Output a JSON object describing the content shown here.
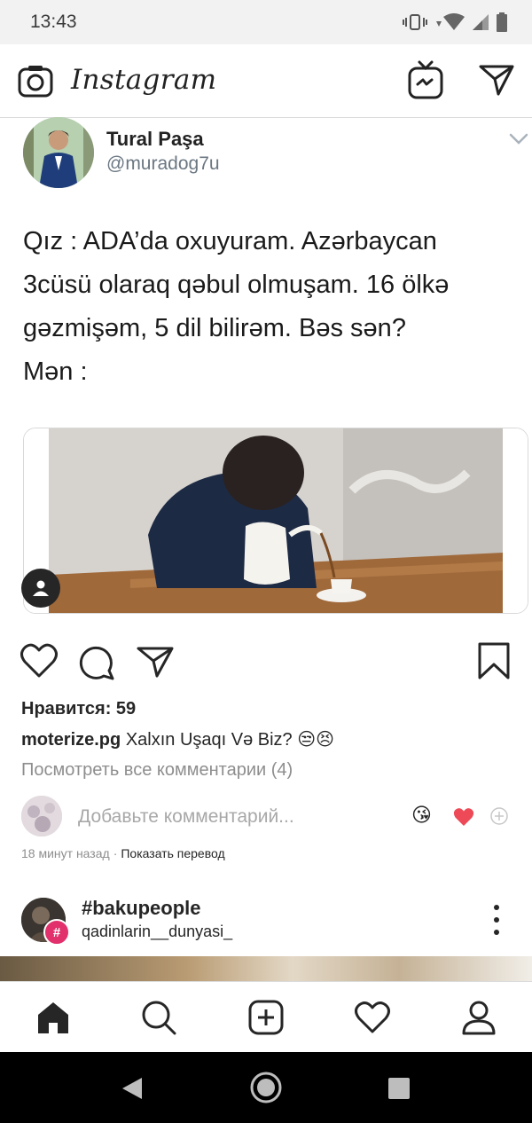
{
  "status_bar": {
    "time": "13:43"
  },
  "header": {
    "brand": "Instagram",
    "icons": [
      "camera-icon",
      "igtv-icon",
      "direct-message-icon"
    ]
  },
  "post": {
    "tweet": {
      "name": "Tural Paşa",
      "handle": "@muradog7u",
      "lines": [
        "Qız : ADA’da oxuyuram. Azərbaycan",
        "3cüsü olaraq qəbul olmuşam. 16 ölkə",
        "gəzmişəm, 5 dil bilirəm. Bəs sən?",
        "Mən :"
      ]
    },
    "likes": "Нравится: 59",
    "caption": {
      "username": "moterize.pg",
      "text": "Xalxın Uşaqı Və Biz? 😒😣"
    },
    "view_comments": "Посмотреть все комментарии (4)",
    "comment_placeholder": "Добавьте комментарий...",
    "quick_reactions": [
      "😘",
      "❤️",
      "+"
    ],
    "timestamp": "18 минут назад",
    "translate": "Показать перевод"
  },
  "next_post": {
    "title": "#bakupeople",
    "subtitle": "qadinlarin__dunyasi_",
    "badge": "#"
  },
  "bottom_nav": [
    "home-icon",
    "search-icon",
    "new-post-icon",
    "activity-heart-icon",
    "profile-icon"
  ],
  "colors": {
    "accent": "#e1306c",
    "text": "#262626",
    "muted": "#8e8e8e",
    "heart": "#ed4956"
  }
}
